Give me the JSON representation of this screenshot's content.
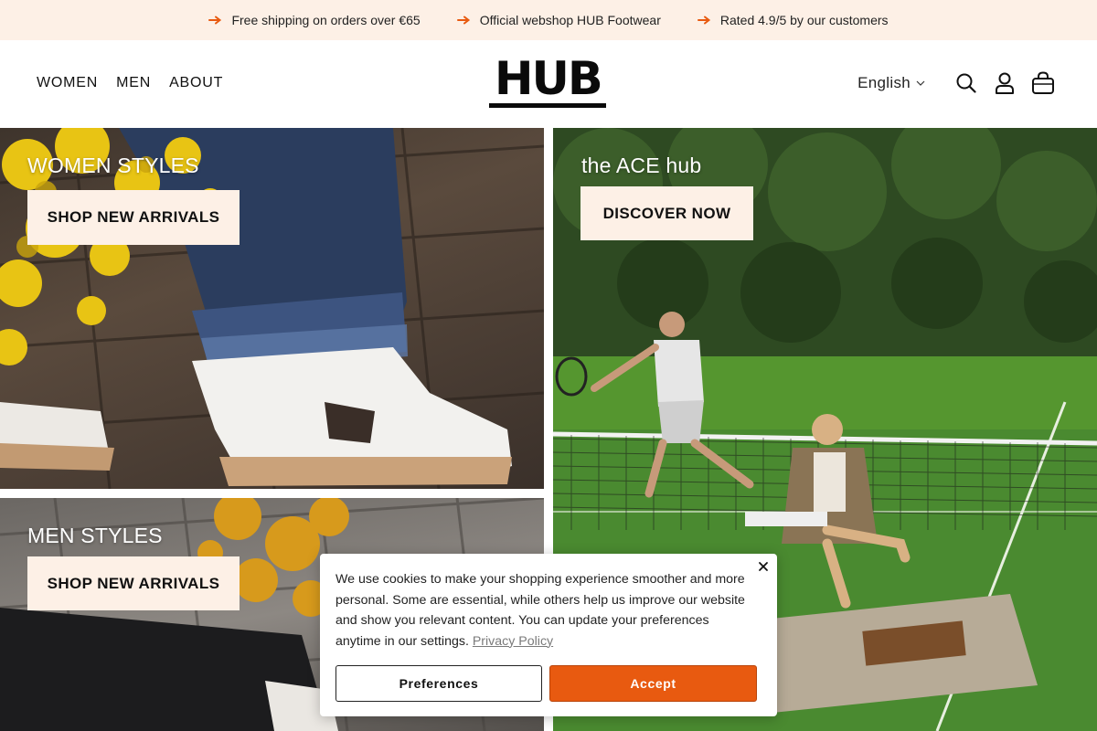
{
  "announcement": {
    "items": [
      {
        "text": "Free shipping on orders over €65",
        "icon": "arrow-right-icon"
      },
      {
        "text": "Official webshop HUB Footwear",
        "icon": "arrow-right-icon"
      },
      {
        "text": "Rated 4.9/5 by our customers",
        "icon": "arrow-right-icon"
      }
    ],
    "accent": "#e85a10",
    "background": "#fdf0e6"
  },
  "header": {
    "nav": [
      "WOMEN",
      "MEN",
      "ABOUT"
    ],
    "logo": "HUB",
    "language": "English",
    "icons": [
      "search-icon",
      "account-icon",
      "cart-icon"
    ]
  },
  "tiles": {
    "women": {
      "title": "WOMEN STYLES",
      "button": "SHOP NEW ARRIVALS"
    },
    "ace": {
      "title": "the ACE hub",
      "button": "DISCOVER NOW"
    },
    "men": {
      "title": "MEN STYLES",
      "button": "SHOP NEW ARRIVALS"
    }
  },
  "cookie": {
    "text": "We use cookies to make your shopping experience smoother and more personal. Some are essential, while others help us improve our website and show you relevant content. You can update your preferences anytime in our settings.",
    "link": "Privacy Policy",
    "preferences": "Preferences",
    "accept": "Accept",
    "accept_color": "#e85a10"
  }
}
